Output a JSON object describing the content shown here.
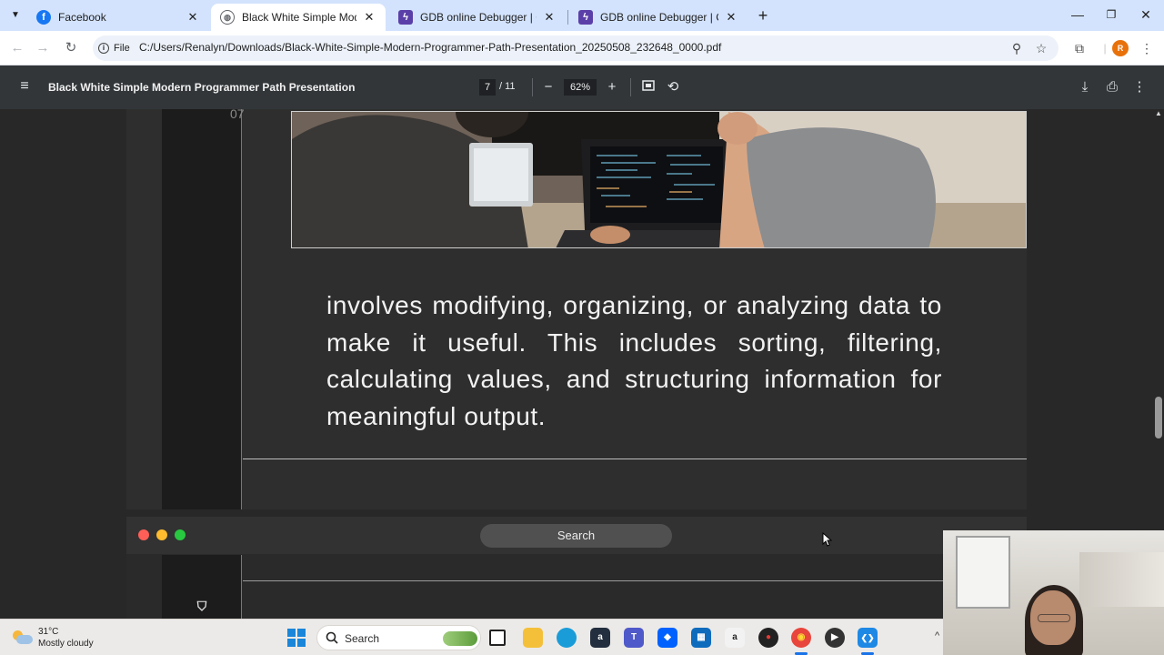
{
  "browser": {
    "tabs": [
      {
        "title": "Facebook",
        "icon": "facebook-icon",
        "color": "#1877f2",
        "active": false
      },
      {
        "title": "Black White Simple Modern Pr",
        "icon": "globe-icon",
        "color": "#5f6368",
        "active": true
      },
      {
        "title": "GDB online Debugger | Compil",
        "icon": "gdb-bolt-icon",
        "color": "#5b3fa8",
        "active": false
      },
      {
        "title": "GDB online Debugger | Compil",
        "icon": "gdb-bolt-icon",
        "color": "#5b3fa8",
        "active": false
      }
    ],
    "close_glyph": "✕",
    "new_tab_glyph": "+",
    "site_chip": "File",
    "url": "C:/Users/Renalyn/Downloads/Black-White-Simple-Modern-Programmer-Path-Presentation_20250508_232648_0000.pdf",
    "profile_initial": "R",
    "profile_color": "#e8710a"
  },
  "pdf": {
    "title": "Black White Simple Modern Programmer Path Presentation",
    "current_page": "7",
    "total_pages": "/ 11",
    "zoom": "62%"
  },
  "slide": {
    "page_label": "07",
    "body_text": "involves modifying, organizing, or analyzing data to make it useful. This includes sorting, filtering, calculating values, and structuring information for meaningful output.",
    "photo": "two-programmers-at-laptops-photo"
  },
  "next_slide": {
    "search_label": "Search",
    "traffic_light_colors": [
      "#ff5f57",
      "#febc2e",
      "#28c840"
    ]
  },
  "taskbar": {
    "temperature": "31°C",
    "weather": "Mostly cloudy",
    "search_label": "Search",
    "apps": [
      {
        "name": "file-explorer-app",
        "color": "#f4c03a",
        "label": ""
      },
      {
        "name": "edge-app",
        "color": "#1a9cd8",
        "label": ""
      },
      {
        "name": "amazon-app",
        "color": "#232f3e",
        "label": "a"
      },
      {
        "name": "teams-app",
        "color": "#5059c9",
        "label": "T"
      },
      {
        "name": "dropbox-app",
        "color": "#0061fe",
        "label": "◆"
      },
      {
        "name": "store-app",
        "color": "#0f6cbd",
        "label": "▦"
      },
      {
        "name": "amazon-shop-app",
        "color": "#f2f2f2",
        "label": "a"
      },
      {
        "name": "game-app",
        "color": "#222222",
        "label": "●"
      },
      {
        "name": "chrome-app",
        "color": "#e8453c",
        "label": "◉"
      },
      {
        "name": "media-player-app",
        "color": "#333333",
        "label": "▶"
      },
      {
        "name": "vscode-app",
        "color": "#1e88e5",
        "label": "❮❯"
      }
    ]
  }
}
